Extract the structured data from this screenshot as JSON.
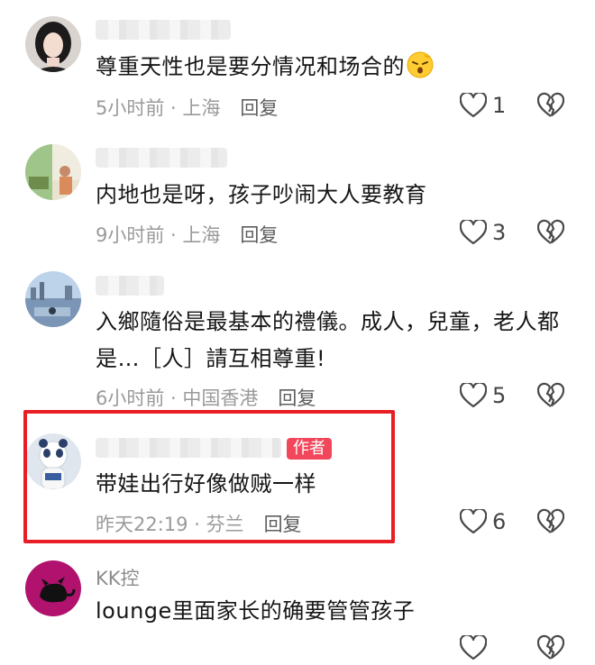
{
  "comments": [
    {
      "text": "尊重天性也是要分情况和场合的",
      "emoji_icon": "tired-face-emoji",
      "time": "5小时前",
      "location": "上海",
      "reply_label": "回复",
      "likes": "1"
    },
    {
      "text": "内地也是呀，孩子吵闹大人要教育",
      "time": "9小时前",
      "location": "上海",
      "reply_label": "回复",
      "likes": "3"
    },
    {
      "text": "入鄉隨俗是最基本的禮儀。成人，兒童，老人都是…［人］請互相尊重!",
      "time": "6小时前",
      "location": "中国香港",
      "reply_label": "回复",
      "likes": "5"
    },
    {
      "badge": "作者",
      "text": "带娃出行好像做贼一样",
      "time": "昨天22:19",
      "location": "芬兰",
      "reply_label": "回复",
      "likes": "6"
    },
    {
      "name": "KK控",
      "text": "lounge里面家长的确要管管孩子",
      "time": "",
      "location": "",
      "reply_label": "",
      "likes": ""
    }
  ],
  "meta_separator": " · ",
  "colors": {
    "highlight_border": "#e81e25",
    "author_badge": "#f2475b",
    "meta_text": "#9a9a9a"
  },
  "icons": {
    "like": "heart-outline-icon",
    "dislike": "broken-heart-icon"
  }
}
